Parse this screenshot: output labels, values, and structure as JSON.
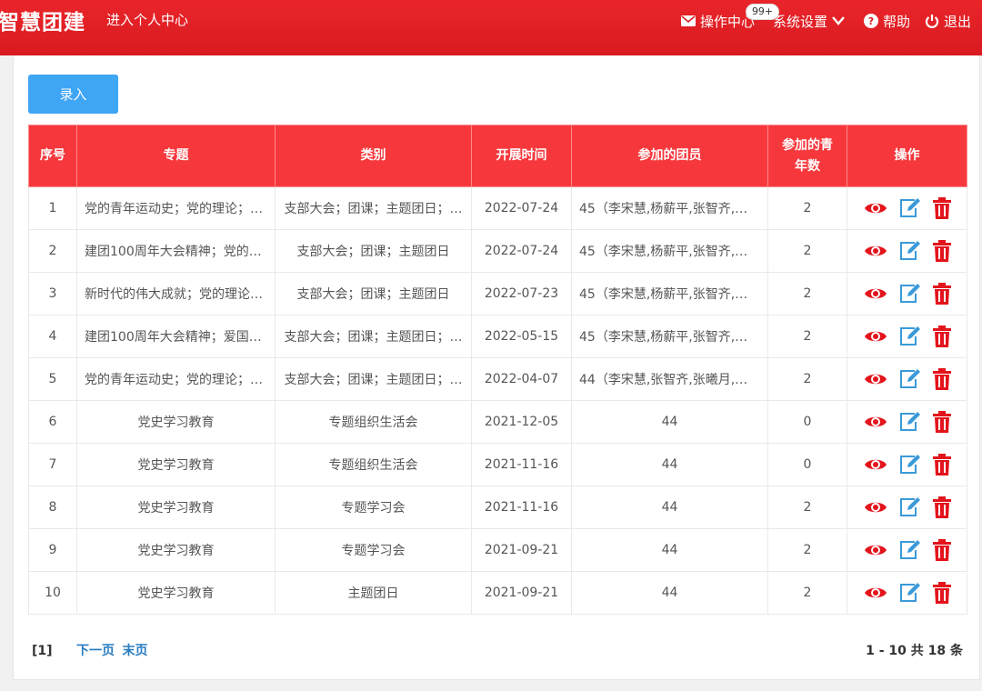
{
  "header": {
    "brand": "智慧团建",
    "personal_center": "进入个人中心",
    "nav": {
      "ops_center": "操作中心",
      "badge": "99+",
      "settings": "系统设置",
      "help": "帮助",
      "logout": "退出"
    }
  },
  "toolbar": {
    "add_label": "录入"
  },
  "table": {
    "headers": {
      "index": "序号",
      "topic": "专题",
      "category": "类别",
      "date": "开展时间",
      "members": "参加的团员",
      "youth1": "参加的青",
      "youth2": "年数",
      "ops": "操作"
    },
    "rows": [
      {
        "index": "1",
        "topic": "党的青年运动史；党的理论；…",
        "category": "支部大会；团课；主题团日；…",
        "date": "2022-07-24",
        "members": "45（李宋慧,杨薪平,张智齐,张…",
        "youth": "2"
      },
      {
        "index": "2",
        "topic": "建团100周年大会精神；党的…",
        "category": "支部大会；团课；主题团日",
        "date": "2022-07-24",
        "members": "45（李宋慧,杨薪平,张智齐,张…",
        "youth": "2"
      },
      {
        "index": "3",
        "topic": "新时代的伟大成就；党的理论…",
        "category": "支部大会；团课；主题团日",
        "date": "2022-07-23",
        "members": "45（李宋慧,杨薪平,张智齐,张…",
        "youth": "2"
      },
      {
        "index": "4",
        "topic": "建团100周年大会精神；爱国…",
        "category": "支部大会；团课；主题团日；…",
        "date": "2022-05-15",
        "members": "45（李宋慧,杨薪平,张智齐,张…",
        "youth": "2"
      },
      {
        "index": "5",
        "topic": "党的青年运动史；党的理论；…",
        "category": "支部大会；团课；主题团日；…",
        "date": "2022-04-07",
        "members": "44（李宋慧,张智齐,张曦月,袁…",
        "youth": "2"
      },
      {
        "index": "6",
        "topic": "党史学习教育",
        "category": "专题组织生活会",
        "date": "2021-12-05",
        "members": "44",
        "youth": "0"
      },
      {
        "index": "7",
        "topic": "党史学习教育",
        "category": "专题组织生活会",
        "date": "2021-11-16",
        "members": "44",
        "youth": "0"
      },
      {
        "index": "8",
        "topic": "党史学习教育",
        "category": "专题学习会",
        "date": "2021-11-16",
        "members": "44",
        "youth": "2"
      },
      {
        "index": "9",
        "topic": "党史学习教育",
        "category": "专题学习会",
        "date": "2021-09-21",
        "members": "44",
        "youth": "2"
      },
      {
        "index": "10",
        "topic": "党史学习教育",
        "category": "主题团日",
        "date": "2021-09-21",
        "members": "44",
        "youth": "2"
      }
    ]
  },
  "pager": {
    "current": "[1]",
    "next": "下一页",
    "last": "末页",
    "summary": "1 - 10 共 18 条"
  },
  "icons": {
    "view": "eye-icon",
    "edit": "edit-icon",
    "delete": "trash-icon"
  },
  "colors": {
    "header": "#e0202a",
    "th": "#f6383d",
    "button": "#3fa5f5",
    "view": "#e3141c",
    "edit": "#3a9ad9",
    "delete": "#e3141c"
  }
}
